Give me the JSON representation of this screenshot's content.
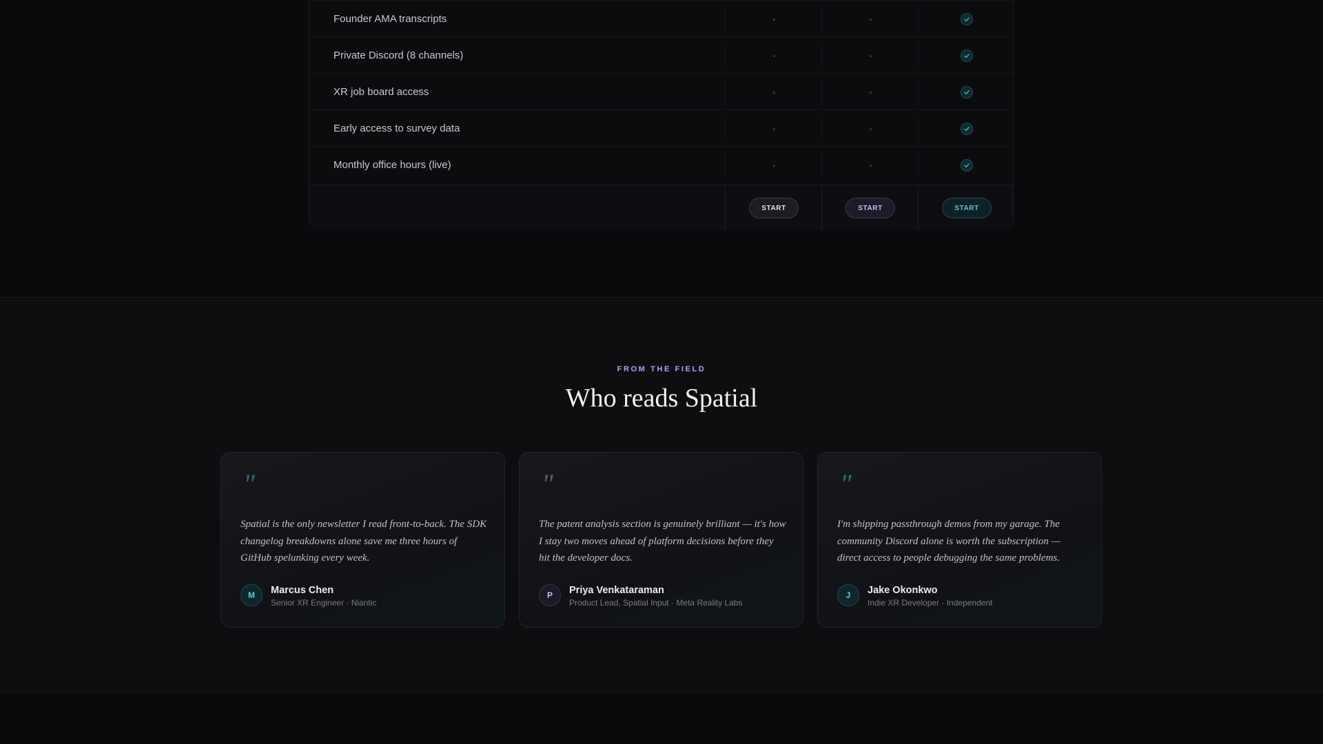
{
  "features": {
    "rows": [
      {
        "label": "Founder AMA transcripts",
        "tier1": false,
        "tier2": false,
        "tier3": true
      },
      {
        "label": "Private Discord (8 channels)",
        "tier1": false,
        "tier2": false,
        "tier3": true
      },
      {
        "label": "XR job board access",
        "tier1": false,
        "tier2": false,
        "tier3": true
      },
      {
        "label": "Early access to survey data",
        "tier1": false,
        "tier2": false,
        "tier3": true
      },
      {
        "label": "Monthly office hours (live)",
        "tier1": false,
        "tier2": false,
        "tier3": true
      }
    ],
    "buttons": [
      {
        "label": "START",
        "color": "#e4e4e8"
      },
      {
        "label": "START",
        "color": "#c9b8ff"
      },
      {
        "label": "START",
        "color": "#56c8d8"
      }
    ]
  },
  "testimonials": {
    "eyebrow": "FROM THE FIELD",
    "heading": "Who reads Spatial",
    "quote_icon": "quote-mark-icon",
    "cards": [
      {
        "quote": "Spatial is the only newsletter I read front-to-back. The SDK changelog breakdowns alone save me three hours of GitHub spelunking every week.",
        "initial": "M",
        "name": "Marcus Chen",
        "role": "Senior XR Engineer · Niantic",
        "accent": "#5ccbd9"
      },
      {
        "quote": "The patent analysis section is genuinely brilliant — it's how I stay two moves ahead of platform decisions before they hit the developer docs.",
        "initial": "P",
        "name": "Priya Venkataraman",
        "role": "Product Lead, Spatial Input · Meta Reality Labs",
        "accent": "#c6b6ff"
      },
      {
        "quote": "I'm shipping passthrough demos from my garage. The community Discord alone is worth the subscription — direct access to people debugging the same problems.",
        "initial": "J",
        "name": "Jake Okonkwo",
        "role": "Indie XR Developer · Independent",
        "accent": "#5ccbd9"
      }
    ]
  }
}
